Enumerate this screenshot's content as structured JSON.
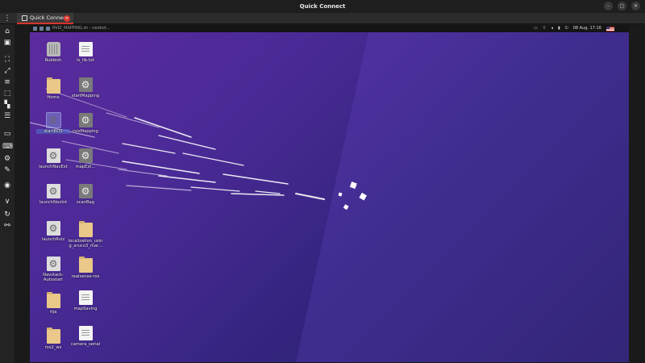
{
  "window": {
    "title": "Quick Connect",
    "controls": [
      "–",
      "▢",
      "✕"
    ]
  },
  "tab": {
    "label": "Quick Connect",
    "close_badge": "×"
  },
  "remote_topbar": {
    "task_title": "RVIZ_MAPPING.sh - neobot...",
    "date_time": "08 Aug, 17:16"
  },
  "desktop_icons": [
    {
      "id": "rubbish",
      "label": "Rubbish",
      "type": "trash"
    },
    {
      "id": "ls_lib",
      "label": "ls_lib.txt",
      "type": "file"
    },
    {
      "id": "home",
      "label": "Home",
      "type": "folder"
    },
    {
      "id": "startmapping",
      "label": "startMapping",
      "type": "gear"
    },
    {
      "id": "startros",
      "label": "startROS",
      "type": "gear-light",
      "selected": true
    },
    {
      "id": "rvizmapping",
      "label": "rvizMapping",
      "type": "gear"
    },
    {
      "id": "launchnavext",
      "label": "launchNavExt",
      "type": "gear-light"
    },
    {
      "id": "mapexp",
      "label": "mapExt...",
      "type": "gear"
    },
    {
      "id": "launchnavint",
      "label": "launchNavInt",
      "type": "gear-light"
    },
    {
      "id": "scanbag",
      "label": "scanBag",
      "type": "gear"
    },
    {
      "id": "launchrviz",
      "label": "launchRviz",
      "type": "gear-light"
    },
    {
      "id": "localization",
      "label": "localization_usin g_aruco3_mar...",
      "type": "folder"
    },
    {
      "id": "navstack",
      "label": "Navstack-Autostart",
      "type": "gear-light"
    },
    {
      "id": "realsense",
      "label": "realsense-ros",
      "type": "folder"
    },
    {
      "id": "rtja",
      "label": "rtja",
      "type": "folder"
    },
    {
      "id": "mapsaving",
      "label": "mapSaving",
      "type": "file"
    },
    {
      "id": "ros2ws",
      "label": "ros2_ws",
      "type": "folder"
    },
    {
      "id": "camera_serial",
      "label": "camera_serial",
      "type": "file"
    }
  ],
  "sidebar_icons": [
    "home-icon",
    "window-icon",
    "fit-icon",
    "fullscreen-icon",
    "menu-icon",
    "select-icon",
    "grid-icon",
    "list-icon",
    "terminal-icon",
    "keyboard-icon",
    "settings-icon",
    "tools-icon",
    "screenshot-icon",
    "chevron-down-icon",
    "refresh-icon",
    "disconnect-icon"
  ],
  "colors": {
    "accent": "#d9342b",
    "wallpaper_top": "#5c2b9e",
    "wallpaper_bottom": "#241b60"
  }
}
